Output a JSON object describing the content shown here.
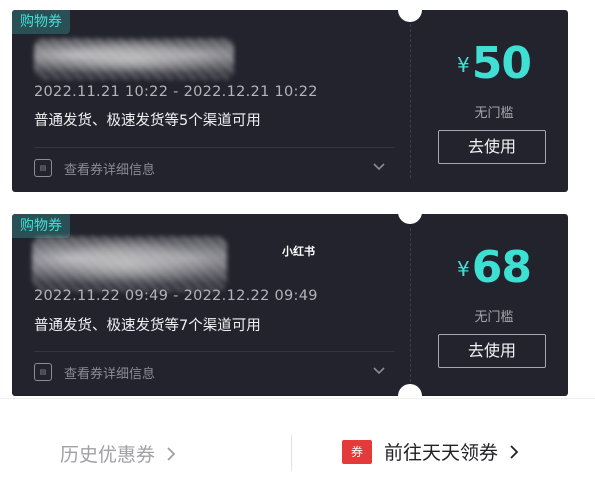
{
  "coupons": [
    {
      "tag": "购物券",
      "date_range": "2022.11.21 10:22 - 2022.12.21 10:22",
      "description": "普通发货、极速发货等5个渠道可用",
      "detail_label": "查看券详细信息",
      "currency": "¥",
      "amount": "50",
      "condition": "无门槛",
      "button_label": "去使用"
    },
    {
      "tag": "购物券",
      "date_range": "2022.11.22 09:49 - 2022.12.22 09:49",
      "description": "普通发货、极速发货等7个渠道可用",
      "detail_label": "查看券详细信息",
      "currency": "¥",
      "amount": "68",
      "condition": "无门槛",
      "button_label": "去使用"
    }
  ],
  "watermark": "小红书",
  "footer": {
    "history_label": "历史优惠券",
    "more_badge": "券",
    "more_label": "前往天天领券"
  },
  "colors": {
    "accent": "#3fe0d4",
    "card_bg": "#23232d",
    "badge_red": "#e53a3a"
  },
  "icons": [
    "detail-info-icon",
    "chevron-down-icon",
    "chevron-right-icon"
  ]
}
